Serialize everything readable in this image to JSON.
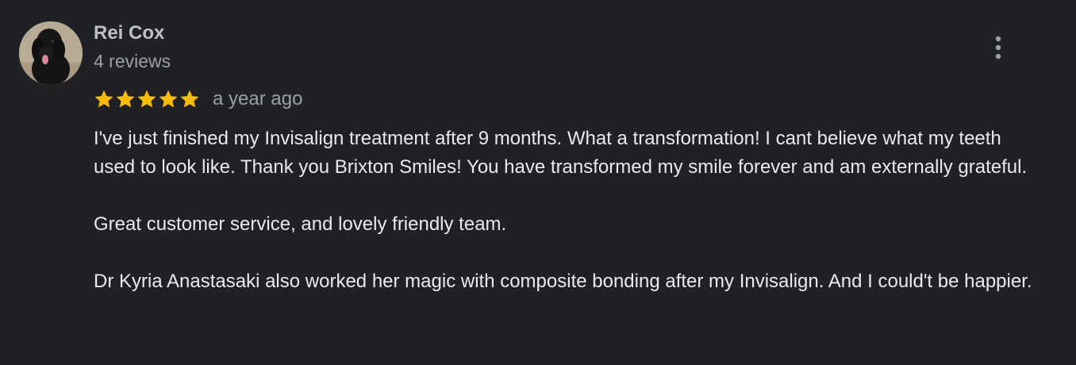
{
  "review": {
    "reviewer_name": "Rei Cox",
    "review_count": "4 reviews",
    "rating": 5,
    "rating_max": 5,
    "date": "a year ago",
    "paragraphs": [
      "I've just finished my Invisalign treatment after 9 months. What a transformation! I cant believe what my teeth used to look like. Thank you Brixton Smiles! You have transformed my smile forever and am externally grateful.",
      "Great customer service, and lovely friendly team.",
      "Dr Kyria Anastasaki also worked her magic with composite bonding after my Invisalign. And I could't be happier."
    ],
    "menu_icon": "more-vert-icon",
    "star_icon": "star-icon"
  },
  "colors": {
    "background": "#202124",
    "star": "#fbbc04",
    "name": "#bdc1c6",
    "secondary": "#9aa0a6",
    "text": "#e8eaed"
  }
}
